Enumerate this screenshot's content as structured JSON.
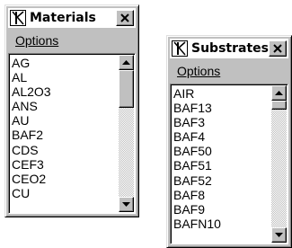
{
  "windows": [
    {
      "title": "Materials",
      "menu": {
        "options_label": "Options"
      },
      "list": {
        "items": [
          "AG",
          "AL",
          "AL2O3",
          "ANS",
          "AU",
          "BAF2",
          "CDS",
          "CEF3",
          "CEO2",
          "CU"
        ]
      },
      "icons": {
        "app": "app-icon",
        "close": "close-icon",
        "up": "up-arrow-icon",
        "down": "down-arrow-icon"
      },
      "scroll": {
        "position_fraction": 0.0,
        "visible_fraction": 0.3
      }
    },
    {
      "title": "Substrates",
      "menu": {
        "options_label": "Options"
      },
      "list": {
        "items": [
          "AIR",
          "BAF13",
          "BAF3",
          "BAF4",
          "BAF50",
          "BAF51",
          "BAF52",
          "BAF8",
          "BAF9",
          "BAFN10"
        ]
      },
      "icons": {
        "app": "app-icon",
        "close": "close-icon",
        "up": "up-arrow-icon",
        "down": "down-arrow-icon"
      },
      "scroll": {
        "position_fraction": 0.0,
        "visible_fraction": 0.07
      }
    }
  ],
  "colors": {
    "face": "#c0c0c0",
    "title_bg": "#ffffff",
    "list_bg": "#ffffff",
    "text": "#000000"
  }
}
